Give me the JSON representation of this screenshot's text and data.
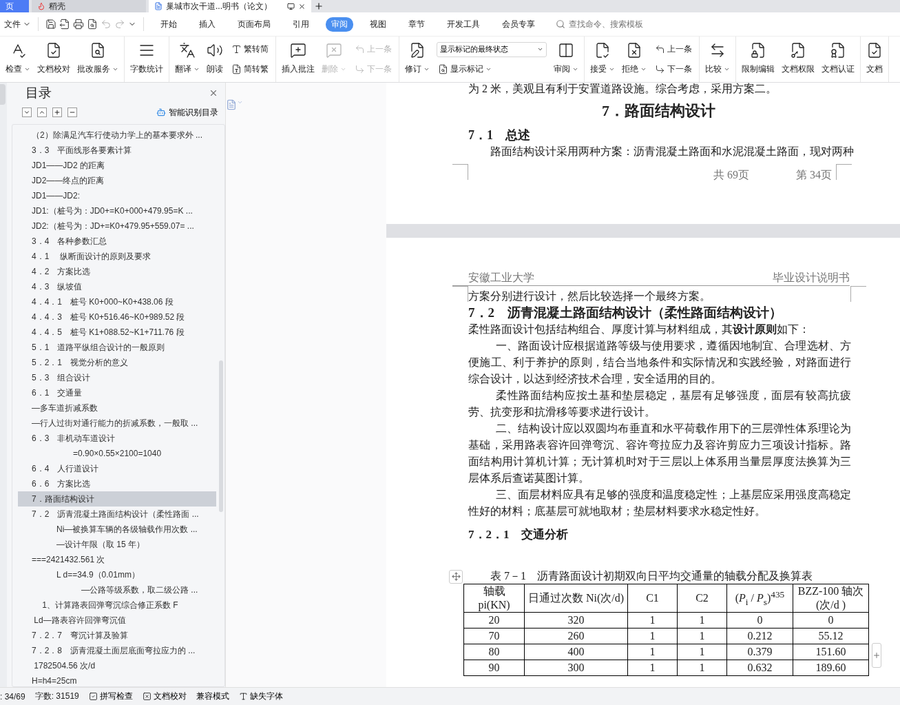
{
  "title_tabs": [
    {
      "label": "页",
      "selected": false,
      "kind": "home"
    },
    {
      "label": "稻壳",
      "selected": false,
      "kind": "app"
    },
    {
      "label": "巢城市次干道...明书（论文）",
      "selected": true,
      "kind": "doc"
    }
  ],
  "menu": {
    "file": "文件",
    "tabs": [
      {
        "label": "开始",
        "selected": false
      },
      {
        "label": "插入",
        "selected": false
      },
      {
        "label": "页面布局",
        "selected": false
      },
      {
        "label": "引用",
        "selected": false
      },
      {
        "label": "审阅",
        "selected": true
      },
      {
        "label": "视图",
        "selected": false
      },
      {
        "label": "章节",
        "selected": false
      },
      {
        "label": "开发工具",
        "selected": false
      },
      {
        "label": "会员专享",
        "selected": false
      }
    ],
    "search": {
      "placeholder": "查找命令、搜索模板"
    }
  },
  "ribbon": [
    {
      "items": [
        {
          "kind": "big",
          "label": "检查",
          "dropdown": true,
          "disabled": false
        },
        {
          "kind": "big",
          "label": "文档校对",
          "dropdown": false,
          "disabled": false
        },
        {
          "kind": "big",
          "label": "批改服务",
          "dropdown": true,
          "disabled": false
        }
      ]
    },
    {
      "items": [
        {
          "kind": "big",
          "label": "字数统计",
          "dropdown": false,
          "disabled": false
        }
      ]
    },
    {
      "items": [
        {
          "kind": "big",
          "label": "翻译",
          "dropdown": true,
          "disabled": false
        },
        {
          "kind": "big",
          "label": "朗读",
          "dropdown": false,
          "disabled": false
        },
        {
          "kind": "stack",
          "items": [
            {
              "label": "繁转简",
              "disabled": false
            },
            {
              "label": "简转繁",
              "disabled": false
            }
          ]
        }
      ]
    },
    {
      "items": [
        {
          "kind": "big",
          "label": "插入批注",
          "dropdown": false,
          "disabled": false
        },
        {
          "kind": "big",
          "label": "删除",
          "dropdown": true,
          "disabled": true
        },
        {
          "kind": "stack",
          "items": [
            {
              "label": "上一条",
              "disabled": true
            },
            {
              "label": "下一条",
              "disabled": true
            }
          ]
        }
      ]
    },
    {
      "items": [
        {
          "kind": "big",
          "label": "修订",
          "dropdown": true,
          "disabled": false
        },
        {
          "kind": "select",
          "value": "显示标记的最终状态",
          "label": "显示标记"
        },
        {
          "kind": "big",
          "label": "审阅",
          "dropdown": true,
          "disabled": false
        }
      ]
    },
    {
      "items": [
        {
          "kind": "big",
          "label": "接受",
          "dropdown": true,
          "disabled": false
        },
        {
          "kind": "big",
          "label": "拒绝",
          "dropdown": true,
          "disabled": false
        },
        {
          "kind": "stack",
          "items": [
            {
              "label": "上一条",
              "disabled": false
            },
            {
              "label": "下一条",
              "disabled": false
            }
          ]
        }
      ]
    },
    {
      "items": [
        {
          "kind": "big",
          "label": "比较",
          "dropdown": true,
          "disabled": false
        }
      ]
    },
    {
      "items": [
        {
          "kind": "big",
          "label": "限制编辑",
          "dropdown": false,
          "disabled": false
        },
        {
          "kind": "big",
          "label": "文档权限",
          "dropdown": false,
          "disabled": false
        },
        {
          "kind": "big",
          "label": "文档认证",
          "dropdown": false,
          "disabled": false
        }
      ]
    },
    {
      "items": [
        {
          "kind": "big",
          "label": "文档",
          "dropdown": false,
          "disabled": false
        }
      ]
    }
  ],
  "sidebar": {
    "title": "目录",
    "smart_button": "智能识别目录",
    "items": [
      {
        "text": "（2）除满足汽车行使动力学上的基本要求外 ...",
        "selected": false
      },
      {
        "text": "3．3　平面线形各要素计算",
        "selected": false
      },
      {
        "text": "JD1——JD2 的距离",
        "selected": false
      },
      {
        "text": "JD2——终点的距离",
        "selected": false
      },
      {
        "text": "JD1——JD2:",
        "selected": false
      },
      {
        "text": "JD1:（桩号为：JD0+=K0+000+479.95=K ...",
        "selected": false
      },
      {
        "text": "JD2:（桩号为：JD+=K0+479.95+559.07= ...",
        "selected": false
      },
      {
        "text": "3．4　各种参数汇总",
        "selected": false
      },
      {
        "text": "4．1　 纵断面设计的原则及要求",
        "selected": false
      },
      {
        "text": "4．2　方案比选",
        "selected": false
      },
      {
        "text": "4．3　纵坡值",
        "selected": false
      },
      {
        "text": "4．4．1　桩号 K0+000~K0+438.06 段",
        "selected": false
      },
      {
        "text": "4．4．3　桩号 K0+516.46~K0+989.52 段",
        "selected": false
      },
      {
        "text": "4．4．5　桩号 K1+088.52~K1+711.76 段",
        "selected": false
      },
      {
        "text": "5．1　道路平纵组合设计的一般原则",
        "selected": false
      },
      {
        "text": "5．2．1　视觉分析的意义",
        "selected": false
      },
      {
        "text": "5．3　组合设计",
        "selected": false
      },
      {
        "text": "6．1　交通量",
        "selected": false
      },
      {
        "text": "—多车道折减系数",
        "selected": false
      },
      {
        "text": "—行人过街对通行能力的折减系数，一般取 ...",
        "selected": false
      },
      {
        "text": "6．3　非机动车道设计",
        "selected": false
      },
      {
        "text": "　　　　　=0.90×0.55×2100=1040",
        "selected": false
      },
      {
        "text": "6．4　人行道设计",
        "selected": false
      },
      {
        "text": "6．6　方案比选",
        "selected": false
      },
      {
        "text": "7．路面结构设计",
        "selected": true
      },
      {
        "text": "7．2　沥青混凝土路面结构设计（柔性路面 ...",
        "selected": false
      },
      {
        "text": "　　　Ni—被换算车辆的各级轴载作用次数 ...",
        "selected": false
      },
      {
        "text": "　　　—设计年限（取 15 年）",
        "selected": false
      },
      {
        "text": "===2421432.561 次",
        "selected": false
      },
      {
        "text": "　　　L d==34.9（0.01mm）",
        "selected": false
      },
      {
        "text": "　　　　　　—公路等级系数，取二级公路 ...",
        "selected": false
      },
      {
        "text": "　 1、计算路表回弹弯沉综合修正系数 F",
        "selected": false
      },
      {
        "text": " Ld—路表容许回弹弯沉值",
        "selected": false
      },
      {
        "text": "7．2．7　弯沉计算及验算",
        "selected": false
      },
      {
        "text": "7．2．8　沥青混凝土面层底面弯拉应力的 ...",
        "selected": false
      },
      {
        "text": " 1782504.56 次/d",
        "selected": false
      },
      {
        "text": "H=h4=25cm",
        "selected": false
      }
    ]
  },
  "document": {
    "page_top": {
      "tail_line": "为 2 米，美观且有利于安置道路设施。综合考虑，采用方案二。",
      "heading": "7．路面结构设计",
      "subheading": "7．1　总述",
      "paragraph": "路面结构设计采用两种方案：沥青混凝土路面和水泥混凝土路面，现对两种",
      "footer_total": "共 69页",
      "footer_page": "第 34页"
    },
    "page_next": {
      "header_left": "安徽工业大学",
      "header_right": "毕业设计说明书",
      "blocks": [
        {
          "kind": "p",
          "text": "方案分别进行设计，然后比较选择一个最终方案。"
        },
        {
          "kind": "h2",
          "text": "7．2　沥青混凝土路面结构设计（柔性路面结构设计）"
        },
        {
          "kind": "p",
          "text": "柔性路面设计包括结构组合、厚度计算与材料组成，其**设计原则**如下："
        },
        {
          "kind": "indent",
          "text": "一、路面设计应根据道路等级与使用要求，遵循因地制宜、合理选材、方便施工、利于养护的原则，结合当地条件和实际情况和实践经验，对路面进行综合设计，以达到经济技术合理，安全适用的目的。"
        },
        {
          "kind": "indent",
          "text": "柔性路面结构应按土基和垫层稳定，基层有足够强度，面层有较高抗疲劳、抗变形和抗滑移等要求进行设计。"
        },
        {
          "kind": "indent",
          "text": "二、结构设计应以双圆均布垂直和水平荷载作用下的三层弹性体系理论为基础，采用路表容许回弹弯沉、容许弯拉应力及容许剪应力三项设计指标。路面结构用计算机计算；无计算机时对于三层以上体系用当量层厚度法换算为三层体系后查诺莫图计算。"
        },
        {
          "kind": "indent",
          "text": "三、面层材料应具有足够的强度和温度稳定性；上基层应采用强度高稳定性好的材料；底基层可就地取材；垫层材料要求水稳定性好。"
        },
        {
          "kind": "h3",
          "text": "7．2．1　交通分析"
        }
      ],
      "table": {
        "caption": "表 7－1　沥青路面设计初期双向日平均交通量的轴载分配及换算表",
        "columns": [
          "轴载 pi(KN)",
          "日通过次数 Ni(次/d)",
          "C1",
          "C2",
          "(*P*$_{i}$ / *P*$_{s}$)$^{435}$",
          "BZZ-100 轴次 (次/d )"
        ],
        "rows": [
          [
            "20",
            "320",
            "1",
            "1",
            "0",
            "0"
          ],
          [
            "70",
            "260",
            "1",
            "1",
            "0.212",
            "55.12"
          ],
          [
            "80",
            "400",
            "1",
            "1",
            "0.379",
            "151.60"
          ],
          [
            "90",
            "300",
            "1",
            "1",
            "0.632",
            "189.60"
          ]
        ]
      }
    }
  },
  "status_bar": {
    "page": ": 34/69",
    "words": "字数: 31519",
    "items": [
      {
        "kind": "check",
        "label": "拼写检查"
      },
      {
        "kind": "cross",
        "label": "文档校对"
      },
      {
        "kind": "plain",
        "label": "兼容模式"
      },
      {
        "kind": "font",
        "label": "缺失字体"
      }
    ]
  }
}
